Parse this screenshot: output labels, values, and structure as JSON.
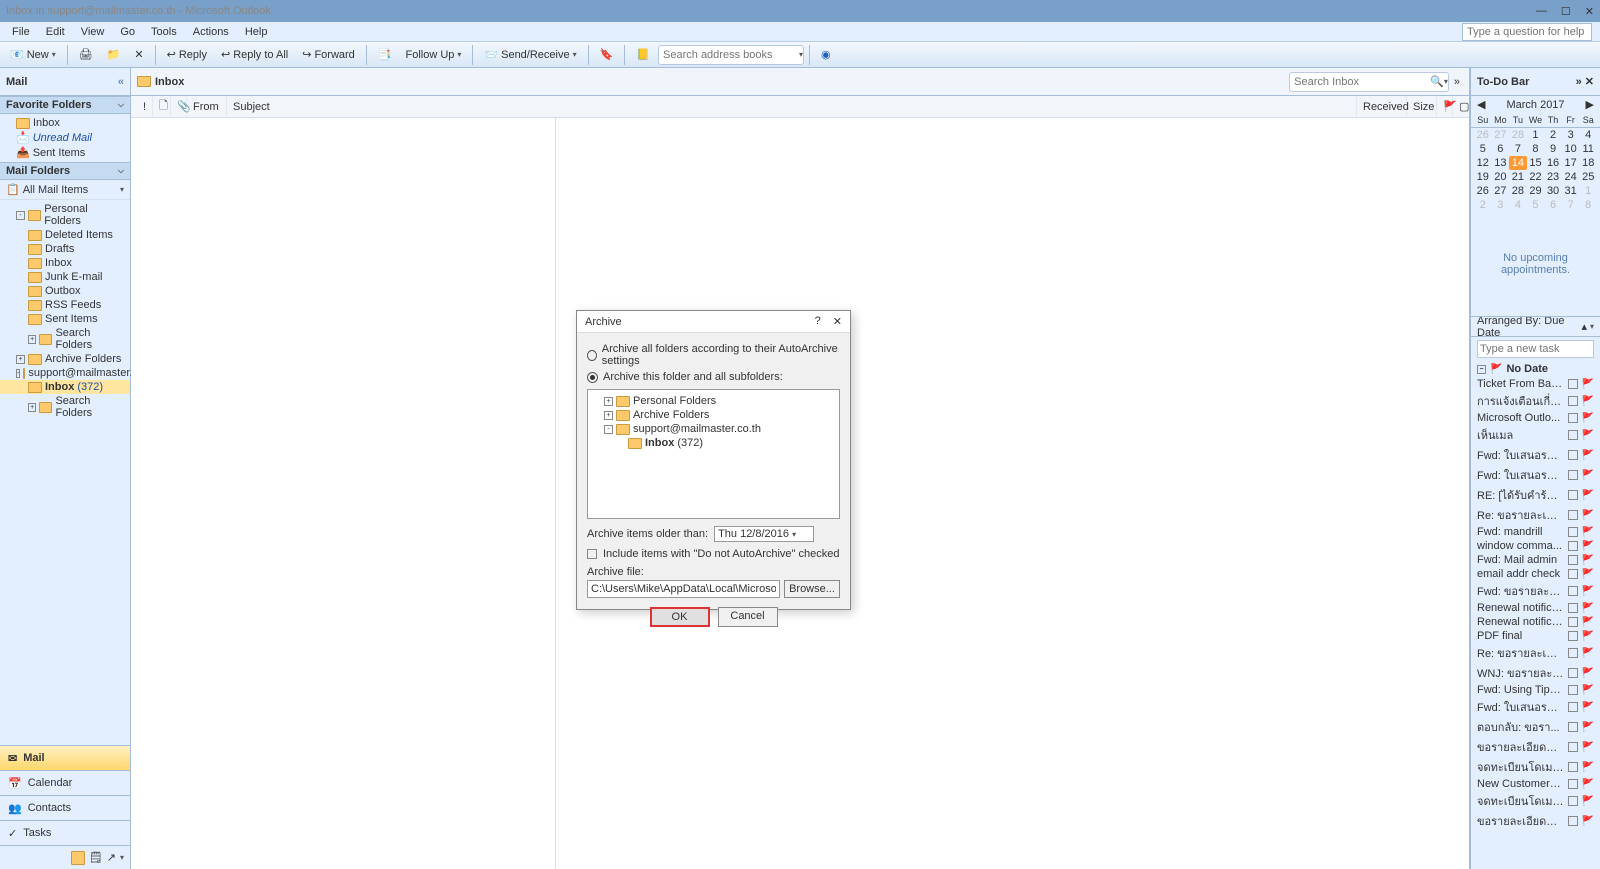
{
  "titlebar": "Inbox in support@mailmaster.co.th - Microsoft Outlook",
  "menus": [
    "File",
    "Edit",
    "View",
    "Go",
    "Tools",
    "Actions",
    "Help"
  ],
  "question_placeholder": "Type a question for help",
  "toolbar": {
    "new": "New",
    "reply": "Reply",
    "reply_all": "Reply to All",
    "forward": "Forward",
    "follow_up": "Follow Up",
    "send_receive": "Send/Receive",
    "search_placeholder": "Search address books"
  },
  "nav": {
    "title": "Mail",
    "fav_hdr": "Favorite Folders",
    "fav": [
      "Inbox",
      "Unread Mail",
      "Sent Items"
    ],
    "mail_hdr": "Mail Folders",
    "all": "All Mail Items",
    "tree": [
      {
        "name": "Personal Folders",
        "lvl": 1,
        "exp": "-"
      },
      {
        "name": "Deleted Items",
        "lvl": 2
      },
      {
        "name": "Drafts",
        "lvl": 2
      },
      {
        "name": "Inbox",
        "lvl": 2
      },
      {
        "name": "Junk E-mail",
        "lvl": 2
      },
      {
        "name": "Outbox",
        "lvl": 2
      },
      {
        "name": "RSS Feeds",
        "lvl": 2
      },
      {
        "name": "Sent Items",
        "lvl": 2
      },
      {
        "name": "Search Folders",
        "lvl": 2,
        "exp": "+"
      },
      {
        "name": "Archive Folders",
        "lvl": 1,
        "exp": "+"
      },
      {
        "name": "support@mailmaster.co",
        "lvl": 1,
        "exp": "-"
      },
      {
        "name": "Inbox",
        "lvl": 2,
        "cnt": "(372)",
        "sel": true
      },
      {
        "name": "Search Folders",
        "lvl": 2,
        "exp": "+"
      }
    ],
    "modules": [
      {
        "name": "Mail",
        "active": true
      },
      {
        "name": "Calendar"
      },
      {
        "name": "Contacts"
      },
      {
        "name": "Tasks"
      }
    ]
  },
  "center": {
    "title": "Inbox",
    "search_placeholder": "Search Inbox",
    "columns_icons": [
      "!",
      "🗋",
      "📎"
    ],
    "cols": {
      "from": "From",
      "subject": "Subject",
      "received": "Received",
      "size": "Size"
    }
  },
  "todobar": {
    "title": "To-Do Bar",
    "month": "March 2017",
    "days": [
      "Su",
      "Mo",
      "Tu",
      "We",
      "Th",
      "Fr",
      "Sa"
    ],
    "cells": [
      [
        26,
        27,
        28,
        1,
        2,
        3,
        4
      ],
      [
        5,
        6,
        7,
        8,
        9,
        10,
        11
      ],
      [
        12,
        13,
        14,
        15,
        16,
        17,
        18
      ],
      [
        19,
        20,
        21,
        22,
        23,
        24,
        25
      ],
      [
        26,
        27,
        28,
        29,
        30,
        31,
        1
      ],
      [
        2,
        3,
        4,
        5,
        6,
        7,
        8
      ]
    ],
    "today_row": 2,
    "today_col": 2,
    "no_appt": "No upcoming appointments.",
    "arranged": "Arranged By: Due Date",
    "newtask": "Type a new task",
    "nodate": "No Date",
    "tasks": [
      "Ticket From Back...",
      "การแจ้งเตือนเกี่ยวก...",
      "Microsoft Outlo...",
      "เห็นเมล",
      "Fwd: ใบเสนอราค...",
      "Fwd: ใบเสนอราค...",
      "RE: [ได้รับคำร้องข...",
      "Re: ขอรายละเอียด...",
      "Fwd: mandrill",
      "window comma...",
      "Fwd: Mail admin",
      "email addr check",
      "Fwd: ขอรายละเอี...",
      "Renewal notifica...",
      "Renewal notifica...",
      "PDF final",
      "Re: ขอรายละเอียด...",
      "WNJ: ขอรายละเอี...",
      "Fwd: Using Tips ...",
      "Fwd: ใบเสนอราคา",
      "ตอบกลับ: ขอรา...",
      "ขอรายละเอียดสำห...",
      "จดทะเบียนโดเมน...",
      "New Customer : ...",
      "จดทะเบียนโดเมน...",
      "ขอรายละเอียดสำห..."
    ]
  },
  "dialog": {
    "title": "Archive",
    "radio_all": "Archive all folders according to their AutoArchive settings",
    "radio_this": "Archive this folder and all subfolders:",
    "tree": [
      {
        "name": "Personal Folders",
        "lvl": 1,
        "exp": "+"
      },
      {
        "name": "Archive Folders",
        "lvl": 1,
        "exp": "+"
      },
      {
        "name": "support@mailmaster.co.th",
        "lvl": 1,
        "exp": "-"
      },
      {
        "name": "Inbox",
        "lvl": 2,
        "cnt": "(372)",
        "bold": true
      }
    ],
    "older_label": "Archive items older than:",
    "older_value": "Thu 12/8/2016",
    "include": "Include items with \"Do not AutoArchive\" checked",
    "file_label": "Archive file:",
    "file_value": "C:\\Users\\Mike\\AppData\\Local\\Microsoft\\Outlook\\s",
    "browse": "Browse...",
    "ok": "OK",
    "cancel": "Cancel"
  }
}
